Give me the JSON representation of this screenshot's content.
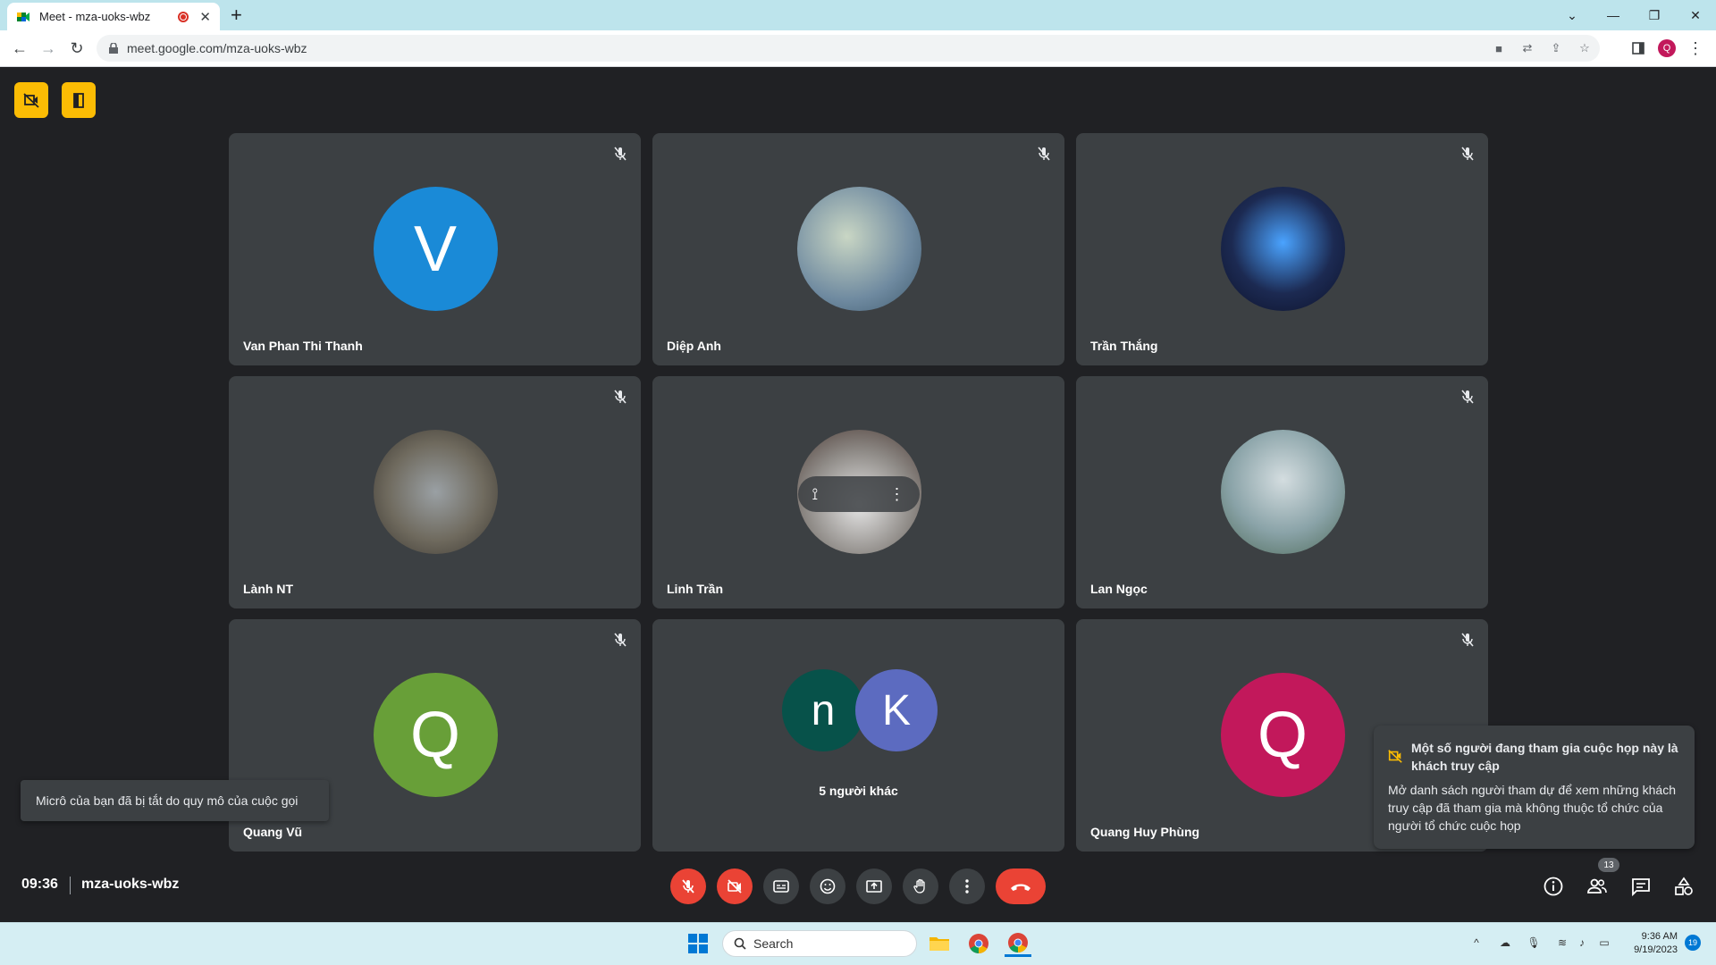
{
  "browser": {
    "tab_title": "Meet - mza-uoks-wbz",
    "url": "meet.google.com/mza-uoks-wbz",
    "profile_initial": "Q"
  },
  "participants": [
    {
      "name": "Van Phan Thi Thanh",
      "initial": "V",
      "color": "#1a8ad7",
      "muted": true
    },
    {
      "name": "Diệp Anh",
      "initial": "",
      "color": "#7a94a8",
      "muted": true
    },
    {
      "name": "Trần Thắng",
      "initial": "",
      "color": "#1c2a52",
      "muted": true
    },
    {
      "name": "Lành NT",
      "initial": "",
      "color": "#6f6a5e",
      "muted": true
    },
    {
      "name": "Linh Trần",
      "initial": "",
      "color": "#8e8a86",
      "muted": false
    },
    {
      "name": "Lan Ngọc",
      "initial": "",
      "color": "#8aa3a8",
      "muted": true
    },
    {
      "name": "Quang Vũ",
      "initial": "Q",
      "color": "#689f38",
      "muted": true
    },
    {
      "name": "Quang Huy Phùng",
      "initial": "Q",
      "color": "#c2185b",
      "muted": true
    }
  ],
  "others_tile": {
    "label": "5 người khác",
    "avatar1_initial": "n",
    "avatar1_color": "#07524a",
    "avatar2_initial": "K",
    "avatar2_color": "#5c6bc0"
  },
  "toast": "Micrô của bạn đã bị tắt do quy mô của cuộc gọi",
  "notice": {
    "title": "Một số người đang tham gia cuộc họp này là khách truy cập",
    "body": "Mở danh sách người tham dự để xem những khách truy cập đã tham gia mà không thuộc tổ chức của người tổ chức cuộc họp"
  },
  "meeting": {
    "time": "09:36",
    "code": "mza-uoks-wbz",
    "participant_count": "13"
  },
  "taskbar": {
    "search_placeholder": "Search",
    "time": "9:36 AM",
    "date": "9/19/2023",
    "notification_count": "19"
  },
  "colors": {
    "accent_yellow": "#fbbc04",
    "danger_red": "#ea4335",
    "tile_bg": "#3c4043",
    "page_bg": "#202124"
  }
}
